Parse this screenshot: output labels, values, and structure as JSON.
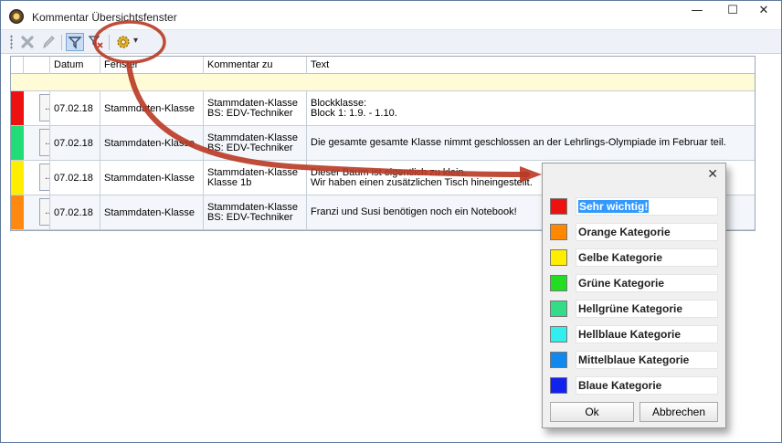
{
  "window": {
    "title": "Kommentar Übersichtsfenster",
    "min_glyph": "—",
    "max_glyph": "☐",
    "close_glyph": "✕"
  },
  "toolbar": {
    "items": [
      "delete-icon",
      "edit-pencil-icon",
      "filter-icon",
      "filter-clear-icon",
      "settings-gear-icon"
    ],
    "dropdown_glyph": "▾"
  },
  "grid": {
    "columns": [
      "Datum",
      "Fenster",
      "Kommentar zu",
      "Text"
    ],
    "rows": [
      {
        "color": "#ee1111",
        "button": "...",
        "datum": "07.02.18",
        "fenster": "Stammdaten-Klasse",
        "kommentar_zu": [
          "Stammdaten-Klasse",
          "BS: EDV-Techniker"
        ],
        "text": [
          "Blockklasse:",
          "Block 1: 1.9. - 1.10."
        ]
      },
      {
        "color": "#22dd77",
        "button": "...",
        "datum": "07.02.18",
        "fenster": "Stammdaten-Klasse",
        "kommentar_zu": [
          "Stammdaten-Klasse",
          "BS: EDV-Techniker"
        ],
        "text": [
          "Die gesamte gesamte Klasse nimmt geschlossen an der Lehrlings-Olympiade im Februar teil."
        ]
      },
      {
        "color": "#ffee00",
        "button": "...",
        "datum": "07.02.18",
        "fenster": "Stammdaten-Klasse",
        "kommentar_zu": [
          "Stammdaten-Klasse",
          "Klasse 1b"
        ],
        "text": [
          "Dieser Baum ist eigentlich zu klein.",
          "Wir haben einen zusätzlichen Tisch hineingestellt."
        ]
      },
      {
        "color": "#ff8811",
        "button": "...",
        "datum": "07.02.18",
        "fenster": "Stammdaten-Klasse",
        "kommentar_zu": [
          "Stammdaten-Klasse",
          "BS: EDV-Techniker"
        ],
        "text": [
          "Franzi und Susi benötigen noch ein Notebook!"
        ]
      }
    ]
  },
  "popup": {
    "close_glyph": "✕",
    "categories": [
      {
        "label": "Sehr wichtig!",
        "color": "#ee1111",
        "selected": true
      },
      {
        "label": "Orange Kategorie",
        "color": "#ff8800"
      },
      {
        "label": "Gelbe Kategorie",
        "color": "#ffee00"
      },
      {
        "label": "Grüne Kategorie",
        "color": "#22dd22"
      },
      {
        "label": "Hellgrüne Kategorie",
        "color": "#33dd88"
      },
      {
        "label": "Hellblaue Kategorie",
        "color": "#33eeee"
      },
      {
        "label": "Mittelblaue Kategorie",
        "color": "#1188ee"
      },
      {
        "label": "Blaue Kategorie",
        "color": "#1122ee"
      }
    ],
    "ok_label": "Ok",
    "cancel_label": "Abbrechen"
  }
}
